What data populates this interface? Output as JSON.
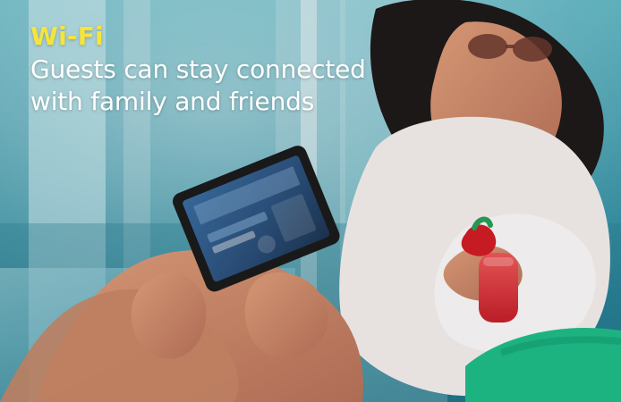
{
  "hero": {
    "kicker": "Wi-Fi",
    "headline_line_1": "Guests can stay connected",
    "headline_line_2": "with family and friends",
    "photo_description_icon": "photo-scene-icon"
  },
  "colors": {
    "accent": "#f5e43b",
    "text": "#ffffff",
    "pool": "#3aa0b3",
    "skin": "#c98766",
    "drink": "#e9333d",
    "top_green": "#1fbf8a"
  }
}
